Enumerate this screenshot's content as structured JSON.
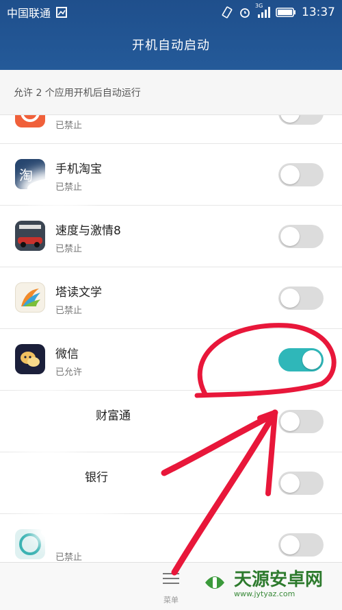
{
  "status_bar": {
    "carrier": "中国联通",
    "network": "3G",
    "time": "13:37"
  },
  "header": {
    "title": "开机自动启动"
  },
  "subheader": {
    "text": "允许 2 个应用开机后自动运行"
  },
  "apps": [
    {
      "name": "",
      "status": "已禁止",
      "enabled": false,
      "icon": "orange-app-icon"
    },
    {
      "name": "手机淘宝",
      "status": "已禁止",
      "enabled": false,
      "icon": "taobao-icon"
    },
    {
      "name": "速度与激情8",
      "status": "已禁止",
      "enabled": false,
      "icon": "fast-furious-icon"
    },
    {
      "name": "塔读文学",
      "status": "已禁止",
      "enabled": false,
      "icon": "taodu-icon"
    },
    {
      "name": "微信",
      "status": "已允许",
      "enabled": true,
      "icon": "wechat-icon"
    },
    {
      "name": "财富通",
      "status": "",
      "enabled": false,
      "icon": "blurred-app-icon"
    },
    {
      "name": "银行",
      "status": "",
      "enabled": false,
      "icon": "blurred-app-icon"
    },
    {
      "name": "",
      "status": "已禁止",
      "enabled": false,
      "icon": "cleaner-app-icon"
    }
  ],
  "bottom_bar": {
    "menu_label": "菜单"
  },
  "watermark": {
    "brand": "天源安卓网",
    "url": "www.jytyaz.com"
  },
  "colors": {
    "header": "#245a99",
    "toggle_on": "#2fb7b9",
    "toggle_off": "#dcdcdc",
    "annotation": "#e8173a"
  }
}
